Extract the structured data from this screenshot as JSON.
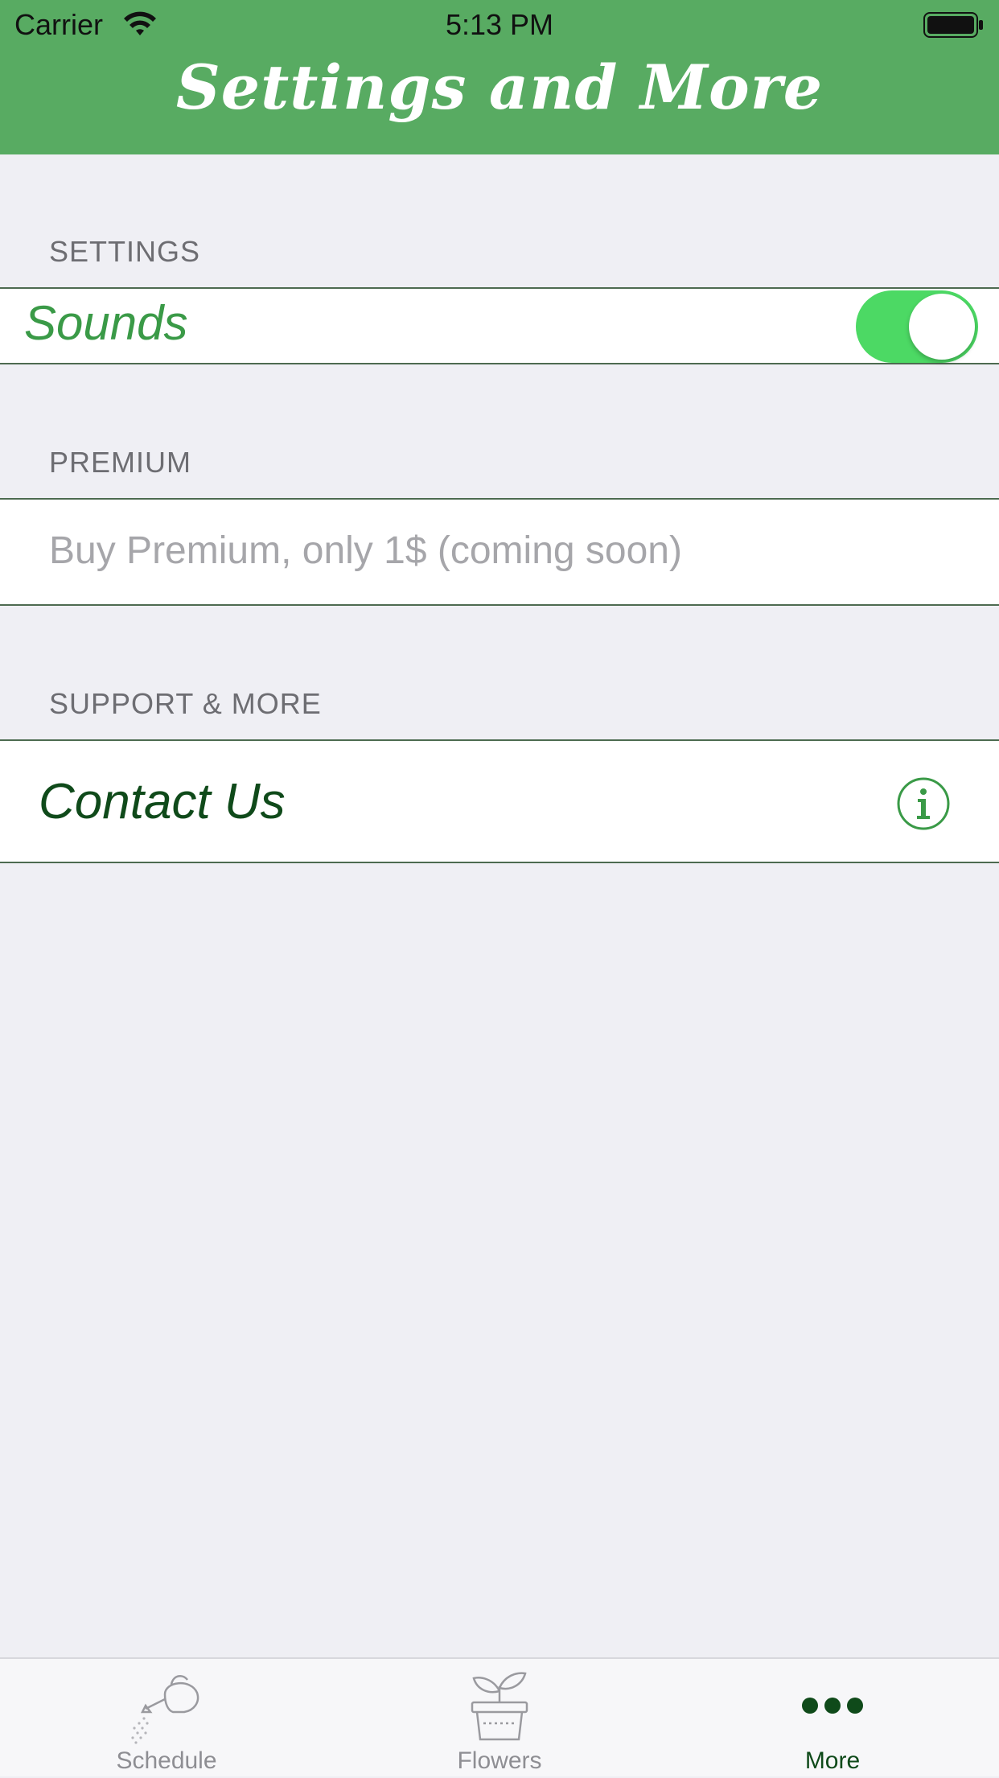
{
  "status_bar": {
    "carrier": "Carrier",
    "time": "5:13 PM"
  },
  "header": {
    "title": "Settings and More"
  },
  "sections": {
    "settings": {
      "header": "SETTINGS",
      "sounds_label": "Sounds",
      "sounds_on": true
    },
    "premium": {
      "header": "PREMIUM",
      "buy_label": "Buy Premium, only 1$ (coming soon)"
    },
    "support": {
      "header": "SUPPORT & MORE",
      "contact_label": "Contact Us",
      "contact_icon": "info-icon"
    }
  },
  "tab_bar": {
    "tabs": [
      {
        "label": "Schedule",
        "icon": "watering-can-icon",
        "selected": false
      },
      {
        "label": "Flowers",
        "icon": "plant-pot-icon",
        "selected": false
      },
      {
        "label": "More",
        "icon": "more-dots-icon",
        "selected": true
      }
    ]
  },
  "colors": {
    "header_green": "#58ab62",
    "toggle_on": "#4cd964",
    "selected_tab": "#0f4a1a",
    "unselected_tab": "#8e8e93",
    "background": "#efeff4"
  }
}
